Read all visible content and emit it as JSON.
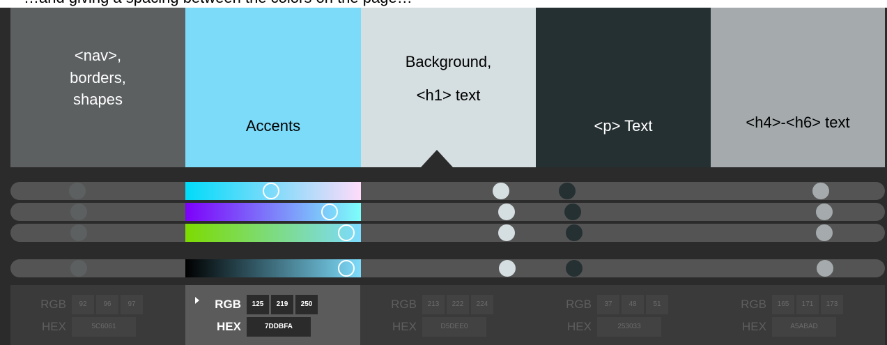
{
  "caption": "…and giving a spacing between the colors on the page…",
  "swatches": [
    {
      "label": "<nav>,\nborders,\nshapes",
      "color": "#5c6061",
      "text_color": "#ffffff"
    },
    {
      "label": "Accents",
      "color": "#7ddbfa",
      "text_color": "#000000"
    },
    {
      "label": "Background,\n<h1> text",
      "color": "#d5dee0",
      "text_color": "#000000"
    },
    {
      "label": "<p> Text",
      "color": "#253033",
      "text_color": "#ffffff"
    },
    {
      "label": "<h4>-<h6> text",
      "color": "#a5abad",
      "text_color": "#000000"
    }
  ],
  "selected_swatch": 1,
  "sliders": [
    {
      "channel": "red",
      "gradient": "linear-gradient(90deg, #00dbfa, #ffdbfa)"
    },
    {
      "channel": "green",
      "gradient": "linear-gradient(90deg, #7d00fa, #7dfffa)"
    },
    {
      "channel": "blue",
      "gradient": "linear-gradient(90deg, #7ddb00, #7ddbff)"
    },
    {
      "channel": "lightness",
      "gradient": "linear-gradient(90deg, #000000, #7ddbfa)"
    }
  ],
  "values": [
    {
      "rgb_label": "RGB",
      "hex_label": "HEX",
      "rgb": [
        "92",
        "96",
        "97"
      ],
      "hex": "5C6061"
    },
    {
      "rgb_label": "RGB",
      "hex_label": "HEX",
      "rgb": [
        "125",
        "219",
        "250"
      ],
      "hex": "7DDBFA"
    },
    {
      "rgb_label": "RGB",
      "hex_label": "HEX",
      "rgb": [
        "213",
        "222",
        "224"
      ],
      "hex": "D5DEE0"
    },
    {
      "rgb_label": "RGB",
      "hex_label": "HEX",
      "rgb": [
        "37",
        "48",
        "51"
      ],
      "hex": "253033"
    },
    {
      "rgb_label": "RGB",
      "hex_label": "HEX",
      "rgb": [
        "165",
        "171",
        "173"
      ],
      "hex": "A5ABAD"
    }
  ]
}
